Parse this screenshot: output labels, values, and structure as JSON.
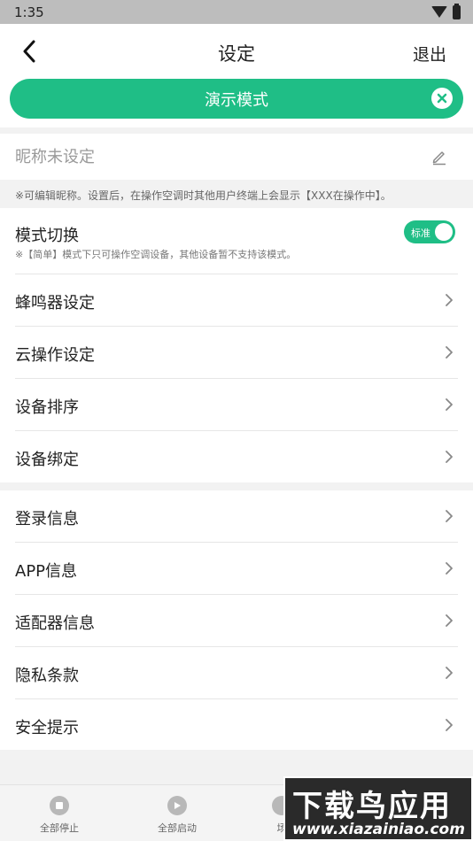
{
  "status_bar": {
    "time": "1:35",
    "wifi_icon": "wifi-icon",
    "battery_icon": "battery-icon"
  },
  "nav": {
    "title": "设定",
    "logout": "退出",
    "back_icon": "chevron-left-icon"
  },
  "demo_banner": {
    "label": "演示模式",
    "close_icon": "close-circle-icon",
    "color": "#1fbe86"
  },
  "nickname": {
    "placeholder": "昵称未设定",
    "value": "",
    "edit_icon": "pencil-icon"
  },
  "nickname_note": "※可编辑昵称。设置后，在操作空调时其他用户终端上会显示【XXX在操作中】。",
  "mode_switch": {
    "title": "模式切换",
    "description": "※【简单】模式下只可操作空调设备，其他设备暂不支持该模式。",
    "toggle_label": "标准",
    "toggle_on": true
  },
  "group1": [
    {
      "label": "蜂鸣器设定"
    },
    {
      "label": "云操作设定"
    },
    {
      "label": "设备排序"
    },
    {
      "label": "设备绑定"
    }
  ],
  "group2": [
    {
      "label": "登录信息"
    },
    {
      "label": "APP信息"
    },
    {
      "label": "适配器信息"
    },
    {
      "label": "隐私条款"
    },
    {
      "label": "安全提示"
    }
  ],
  "bottom_tabs": [
    {
      "label": "全部停止",
      "icon": "stop-circle-icon"
    },
    {
      "label": "全部启动",
      "icon": "play-circle-icon"
    },
    {
      "label": "场",
      "icon": "scene-icon"
    }
  ],
  "watermark": {
    "text": "下载鸟应用",
    "url": "www.xiazainiao.com"
  },
  "colors": {
    "accent": "#1fbe86",
    "background": "#f2f2f2"
  }
}
